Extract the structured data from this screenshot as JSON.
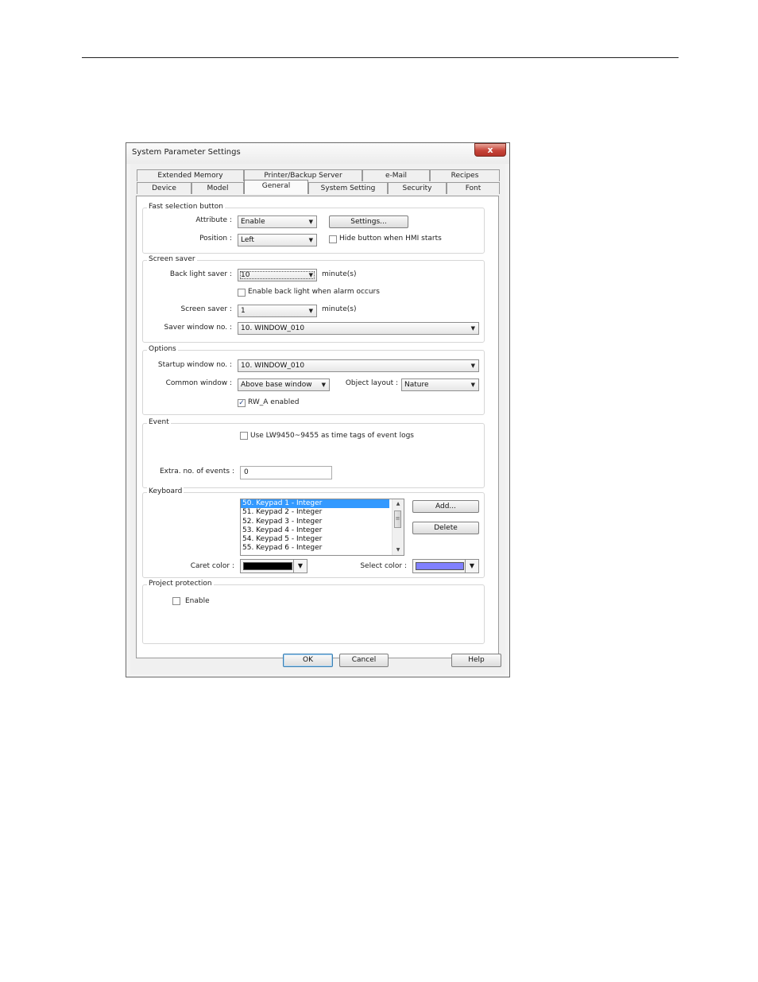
{
  "dialog": {
    "title": "System Parameter Settings",
    "close_label": "x"
  },
  "tabs_row1": [
    "Extended Memory",
    "Printer/Backup Server",
    "e-Mail",
    "Recipes"
  ],
  "tabs_row2": [
    "Device",
    "Model",
    "General",
    "System Setting",
    "Security",
    "Font"
  ],
  "active_tab": "General",
  "fast_selection": {
    "legend": "Fast selection button",
    "attribute_label": "Attribute :",
    "attribute_value": "Enable",
    "settings_button": "Settings...",
    "position_label": "Position :",
    "position_value": "Left",
    "hide_button_label": "Hide button when HMI starts",
    "hide_button_checked": false
  },
  "screen_saver": {
    "legend": "Screen saver",
    "back_light_label": "Back light saver :",
    "back_light_value": "10",
    "back_light_unit": "minute(s)",
    "enable_backlight_alarm_label": "Enable back light when alarm occurs",
    "enable_backlight_alarm_checked": false,
    "screen_saver_label": "Screen saver :",
    "screen_saver_value": "1",
    "screen_saver_unit": "minute(s)",
    "saver_window_label": "Saver window no. :",
    "saver_window_value": "10. WINDOW_010"
  },
  "options": {
    "legend": "Options",
    "startup_window_label": "Startup window no. :",
    "startup_window_value": "10. WINDOW_010",
    "common_window_label": "Common window :",
    "common_window_value": "Above base window",
    "object_layout_label": "Object layout :",
    "object_layout_value": "Nature",
    "rw_a_label": "RW_A enabled",
    "rw_a_checked": true
  },
  "event": {
    "legend": "Event",
    "use_lw_label": "Use LW9450~9455 as time tags of event logs",
    "use_lw_checked": false,
    "extra_events_label": "Extra. no. of events :",
    "extra_events_value": "0"
  },
  "keyboard": {
    "legend": "Keyboard",
    "items": [
      "50. Keypad 1 - Integer",
      "51. Keypad 2 - Integer",
      "52. Keypad 3 - Integer",
      "53. Keypad 4 - Integer",
      "54. Keypad 5 - Integer",
      "55. Keypad 6 - Integer"
    ],
    "selected_index": 0,
    "add_button": "Add...",
    "delete_button": "Delete",
    "caret_color_label": "Caret color :",
    "caret_color": "#000000",
    "select_color_label": "Select color :",
    "select_color": "#8080ff"
  },
  "project_protection": {
    "legend": "Project protection",
    "enable_label": "Enable",
    "enable_checked": false
  },
  "footer": {
    "ok_button": "OK",
    "cancel_button": "Cancel",
    "help_button": "Help"
  },
  "icons": {
    "dropdown": "chevron-down-icon",
    "check": "checkmark-icon",
    "close": "close-icon"
  }
}
